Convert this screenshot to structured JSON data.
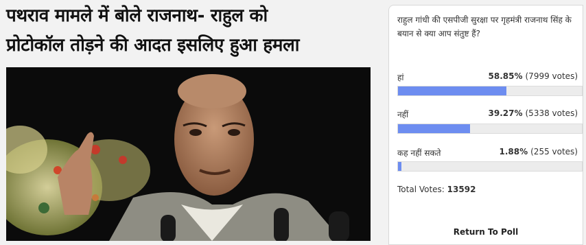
{
  "article": {
    "headline_line1": "पथराव मामले में बोले राजनाथ- राहुल को",
    "headline_line2": "प्रोटोकॉल तोड़ने की आदत इसलिए हुआ हमला"
  },
  "poll": {
    "question": "राहुल गांधी की एसपीजी सुरक्षा पर गृहमंत्री राजनाथ सिंह के बयान से क्या आप संतुष्ट हैं?",
    "options": [
      {
        "label": "हां",
        "percent": "58.85%",
        "votes": "(7999 votes)",
        "fraction": 0.5885
      },
      {
        "label": "नहीं",
        "percent": "39.27%",
        "votes": "(5338 votes)",
        "fraction": 0.3927
      },
      {
        "label": "कह नहीं सकते",
        "percent": "1.88%",
        "votes": "(255 votes)",
        "fraction": 0.0188
      }
    ],
    "total_label": "Total Votes:",
    "total_value": "13592",
    "return_label": "Return To Poll",
    "bar_color": "#6d8df0"
  }
}
